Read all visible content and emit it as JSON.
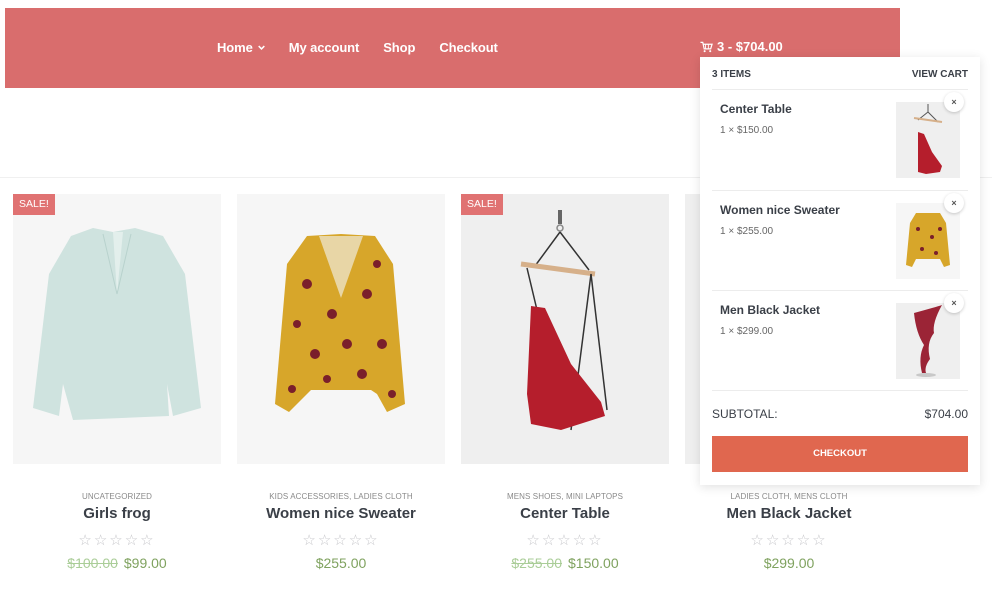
{
  "header": {
    "brand_color": "#d96d6d",
    "nav": [
      {
        "label": "Home",
        "has_dropdown": true
      },
      {
        "label": "My account"
      },
      {
        "label": "Shop"
      },
      {
        "label": "Checkout"
      }
    ],
    "cart_summary": "3 - $704.00",
    "cart_icon": "cart-icon"
  },
  "products": [
    {
      "category": "UNCATEGORIZED",
      "title": "Girls frog",
      "sale_badge": "SALE!",
      "old_price": "$100.00",
      "price": "$99.00",
      "rating": 0,
      "stars": "☆☆☆☆☆"
    },
    {
      "category": "KIDS ACCESSORIES, LADIES CLOTH",
      "title": "Women nice Sweater",
      "sale_badge": null,
      "old_price": null,
      "price": "$255.00",
      "rating": 0,
      "stars": "☆☆☆☆☆"
    },
    {
      "category": "MENS SHOES, MINI LAPTOPS",
      "title": "Center Table",
      "sale_badge": "SALE!",
      "old_price": "$255.00",
      "price": "$150.00",
      "rating": 0,
      "stars": "☆☆☆☆☆"
    },
    {
      "category": "LADIES CLOTH, MENS CLOTH",
      "title": "Men Black Jacket",
      "sale_badge": null,
      "old_price": null,
      "price": "$299.00",
      "rating": 0,
      "stars": "☆☆☆☆☆"
    }
  ],
  "mini_cart": {
    "count_label": "3 ITEMS",
    "view_cart_label": "VIEW CART",
    "items": [
      {
        "name": "Center Table",
        "qty_price": "1 × $150.00",
        "remove": "×"
      },
      {
        "name": "Women nice Sweater",
        "qty_price": "1 × $255.00",
        "remove": "×"
      },
      {
        "name": "Men Black Jacket",
        "qty_price": "1 × $299.00",
        "remove": "×"
      }
    ],
    "subtotal_label": "SUBTOTAL:",
    "subtotal_value": "$704.00",
    "checkout_label": "CHECKOUT",
    "checkout_color": "#e0674f"
  }
}
